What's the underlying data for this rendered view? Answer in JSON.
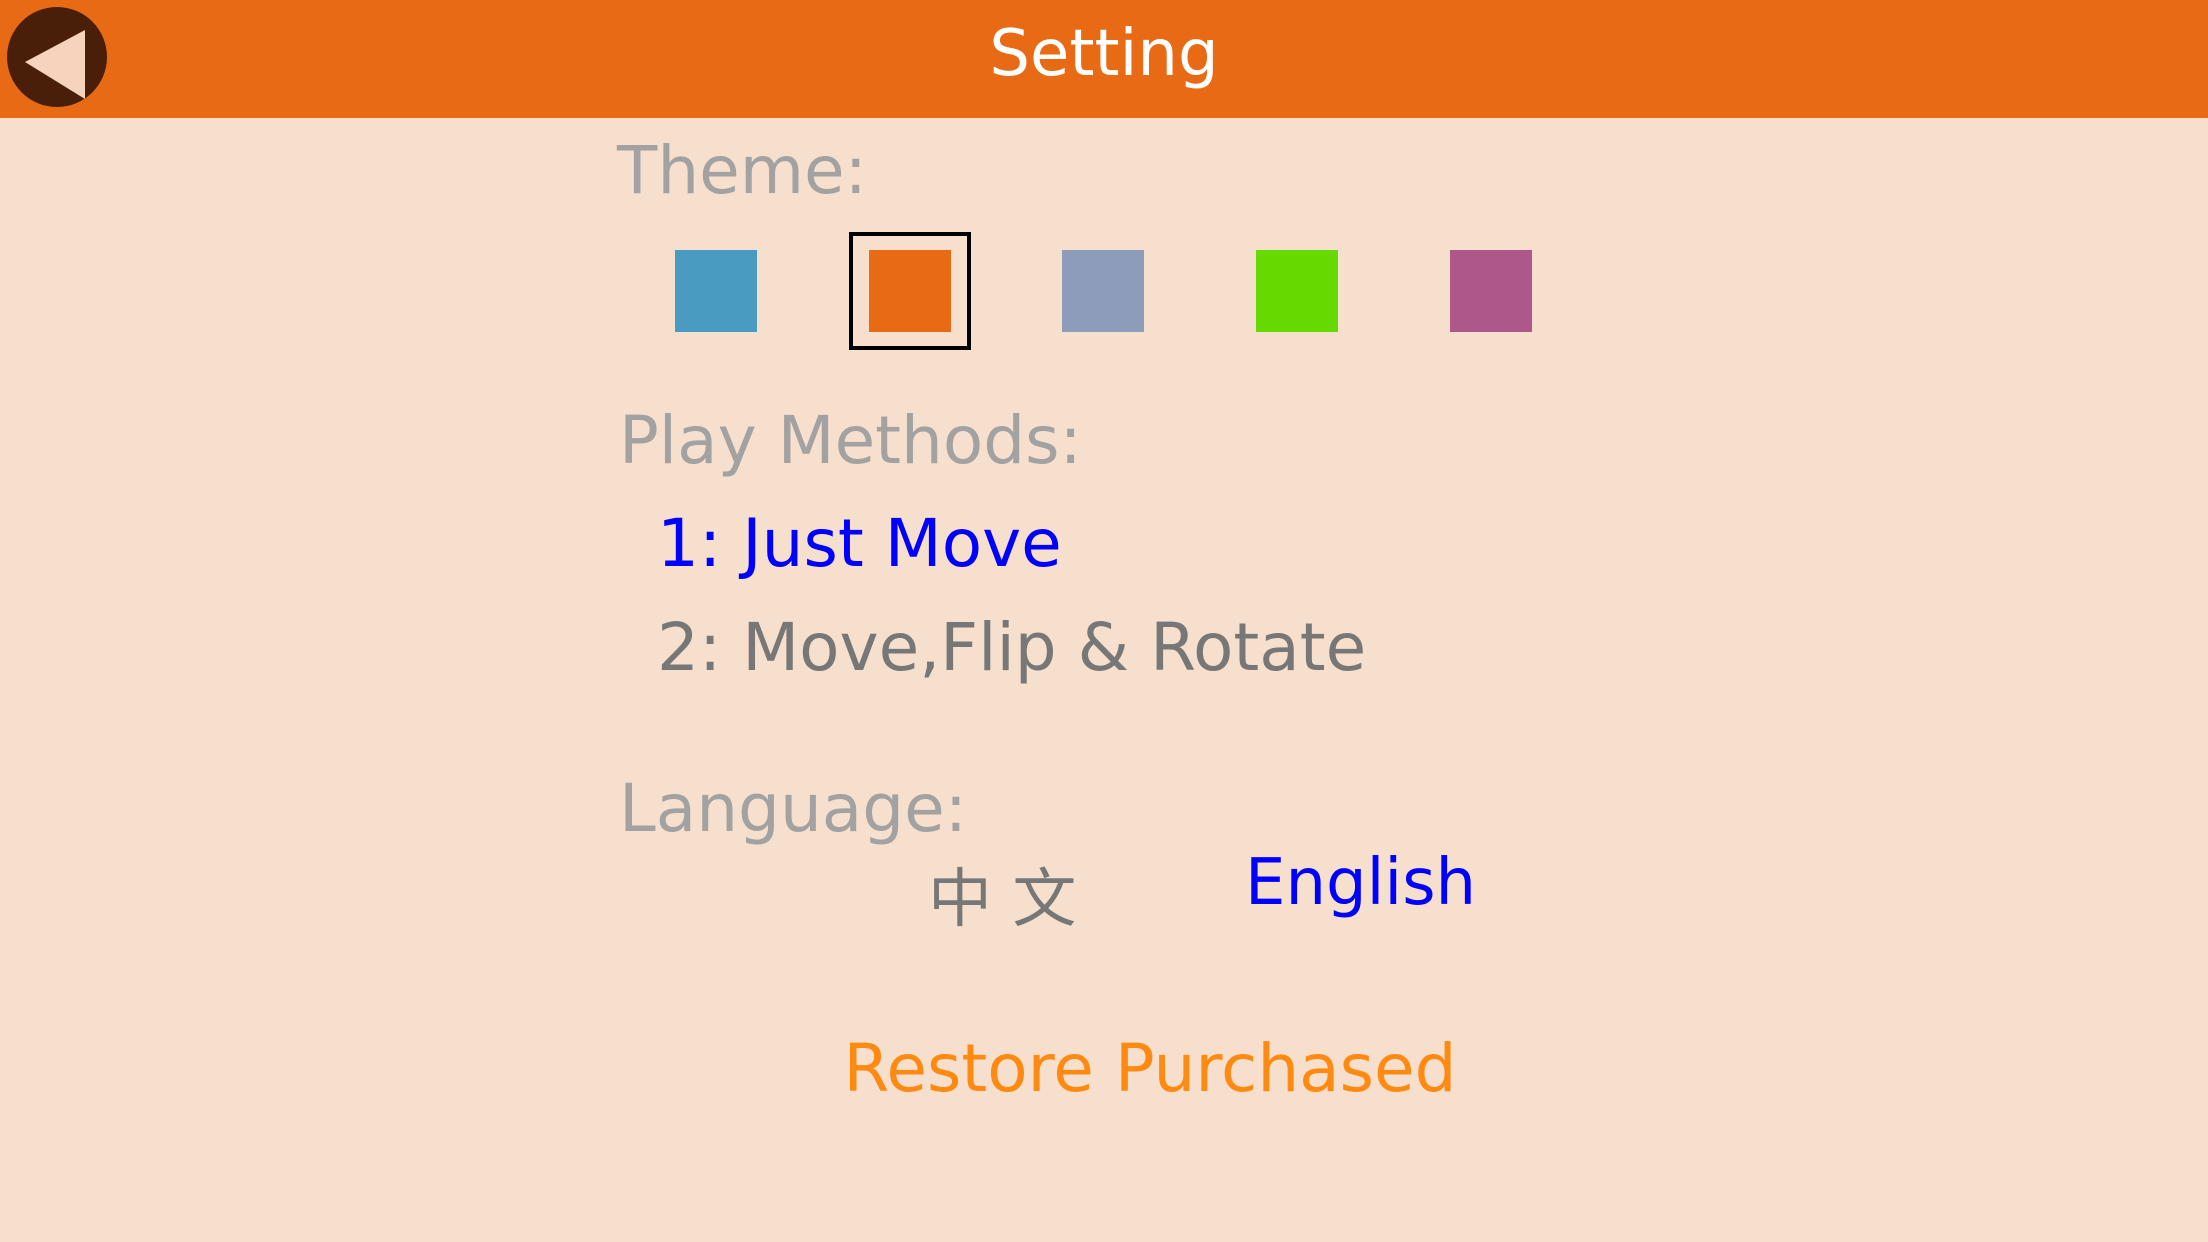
{
  "header": {
    "title": "Setting",
    "back_icon": "back-arrow-icon"
  },
  "theme": {
    "label": "Theme:",
    "selected_index": 1,
    "swatches": [
      {
        "name": "blue",
        "color": "#4a9bc1"
      },
      {
        "name": "orange",
        "color": "#e96a15"
      },
      {
        "name": "lavender",
        "color": "#8e9cbc"
      },
      {
        "name": "green",
        "color": "#66d900"
      },
      {
        "name": "magenta",
        "color": "#ad578b"
      }
    ]
  },
  "play_methods": {
    "label": "Play Methods:",
    "selected_index": 0,
    "options": [
      {
        "label": "1: Just Move"
      },
      {
        "label": "2: Move,Flip & Rotate"
      }
    ]
  },
  "language": {
    "label": "Language:",
    "selected": "English",
    "options": [
      {
        "label": "中 文"
      },
      {
        "label": "English"
      }
    ]
  },
  "restore_label": "Restore Purchased",
  "colors": {
    "accent": "#e96a15",
    "background": "#f7dfcd",
    "selected_text": "#0000ff",
    "unselected_text": "#777777",
    "section_label": "#a2a2a2",
    "restore_text": "#ff8a12"
  }
}
